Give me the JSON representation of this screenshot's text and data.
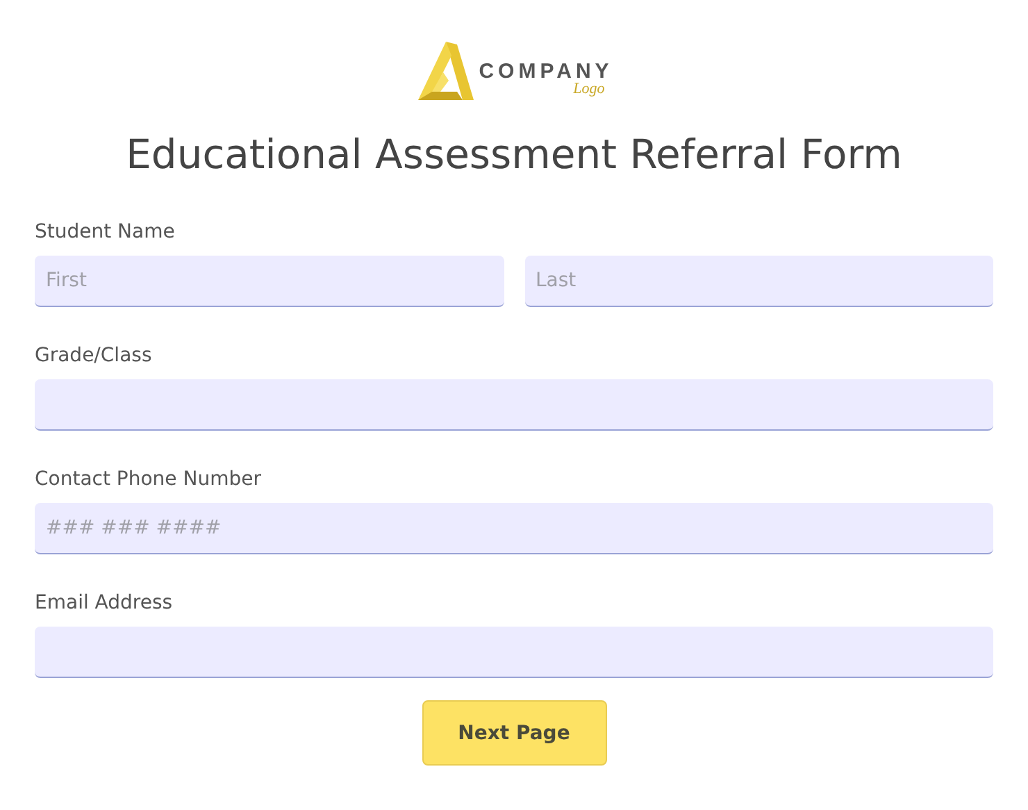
{
  "logo": {
    "name": "COMPANY",
    "tagline": "Logo"
  },
  "title": "Educational Assessment Referral Form",
  "fields": [
    {
      "label": "Student Name",
      "kind": "split",
      "inputs": [
        {
          "placeholder": "First"
        },
        {
          "placeholder": "Last"
        }
      ]
    },
    {
      "label": "Grade/Class",
      "kind": "single"
    },
    {
      "label": "Contact Phone Number",
      "kind": "single",
      "placeholder": "### ### ####"
    },
    {
      "label": "Email Address",
      "kind": "single"
    }
  ],
  "button": "Next Page"
}
